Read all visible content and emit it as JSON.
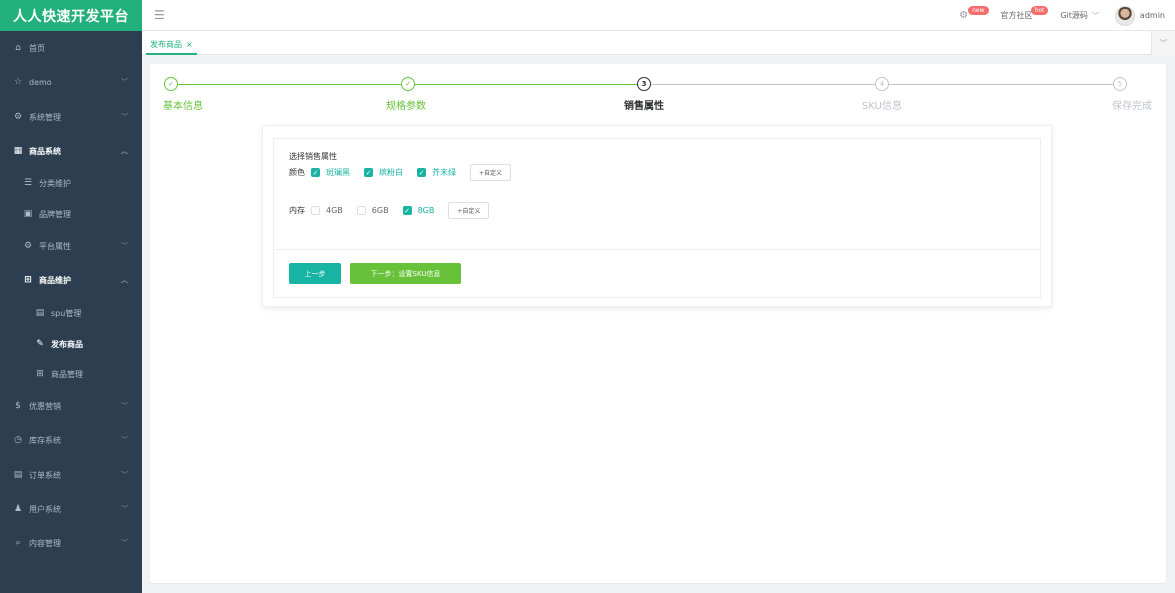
{
  "app": {
    "title": "人人快速开发平台"
  },
  "colors": {
    "brand": "#22b07d",
    "teal": "#17b3a3",
    "next": "#67c23a",
    "sidebar": "#2c3e50"
  },
  "sidebar": {
    "items": [
      {
        "label": "首页",
        "icon": "home-icon",
        "glyph": "⌂",
        "arrow": ""
      },
      {
        "label": "demo",
        "icon": "star-icon",
        "glyph": "☆",
        "arrow": "﹀"
      },
      {
        "label": "系统管理",
        "icon": "settings-icon",
        "glyph": "⚙",
        "arrow": "﹀"
      },
      {
        "label": "商品系统",
        "icon": "grid-icon",
        "glyph": "▦",
        "arrow": "︿"
      },
      {
        "label": "分类维护",
        "icon": "list-icon",
        "glyph": "☰",
        "arrow": ""
      },
      {
        "label": "品牌管理",
        "icon": "tag-icon",
        "glyph": "▣",
        "arrow": ""
      },
      {
        "label": "平台属性",
        "icon": "gear-icon",
        "glyph": "⚙",
        "arrow": "﹀"
      },
      {
        "label": "商品维护",
        "icon": "apps-icon",
        "glyph": "⊞",
        "arrow": "︿"
      },
      {
        "label": "spu管理",
        "icon": "document-icon",
        "glyph": "▤",
        "arrow": ""
      },
      {
        "label": "发布商品",
        "icon": "edit-icon",
        "glyph": "✎",
        "arrow": ""
      },
      {
        "label": "商品管理",
        "icon": "apps-icon",
        "glyph": "⊞",
        "arrow": ""
      },
      {
        "label": "优惠营销",
        "icon": "coupon-icon",
        "glyph": "$",
        "arrow": "﹀"
      },
      {
        "label": "库存系统",
        "icon": "box-icon",
        "glyph": "◷",
        "arrow": "﹀"
      },
      {
        "label": "订单系统",
        "icon": "order-icon",
        "glyph": "▤",
        "arrow": "﹀"
      },
      {
        "label": "用户系统",
        "icon": "user-icon",
        "glyph": "♟",
        "arrow": "﹀"
      },
      {
        "label": "内容管理",
        "icon": "search-icon",
        "glyph": "⌕",
        "arrow": "﹀"
      }
    ]
  },
  "topbar": {
    "menu_icon": "hamburger-icon",
    "badge_new": "new",
    "official_label": "官方社区",
    "badge_hot": "hot",
    "git_label": "Git源码",
    "user_name": "admin"
  },
  "tabs": {
    "active_label": "发布商品",
    "close_glyph": "×"
  },
  "steps": [
    {
      "marker": "✓",
      "title": "基本信息",
      "state": "finish"
    },
    {
      "marker": "✓",
      "title": "规格参数",
      "state": "finish"
    },
    {
      "marker": "3",
      "title": "销售属性",
      "state": "process"
    },
    {
      "marker": "4",
      "title": "SKU信息",
      "state": "wait"
    },
    {
      "marker": "5",
      "title": "保存完成",
      "state": "wait"
    }
  ],
  "sale_attrs": {
    "section_title": "选择销售属性",
    "color_label": "颜色",
    "colors": [
      {
        "label": "斑斓黑",
        "checked": true
      },
      {
        "label": "缤粉白",
        "checked": true
      },
      {
        "label": "芥末绿",
        "checked": true
      }
    ],
    "memory_label": "内存",
    "memory": [
      {
        "label": "4GB",
        "checked": false
      },
      {
        "label": "6GB",
        "checked": false
      },
      {
        "label": "8GB",
        "checked": true
      }
    ],
    "custom_label": "+自定义"
  },
  "buttons": {
    "prev": "上一步",
    "next": "下一步：设置SKU信息"
  }
}
